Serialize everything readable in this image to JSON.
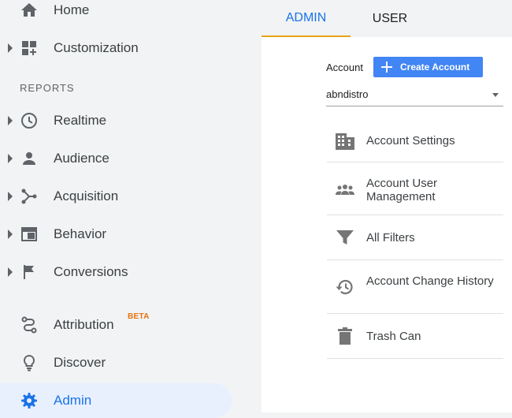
{
  "sidebar": {
    "items": [
      {
        "label": "Home",
        "icon": "home-icon"
      },
      {
        "label": "Customization",
        "icon": "customization-icon"
      },
      {
        "label": "Realtime",
        "icon": "clock-icon"
      },
      {
        "label": "Audience",
        "icon": "person-icon"
      },
      {
        "label": "Acquisition",
        "icon": "acquisition-icon"
      },
      {
        "label": "Behavior",
        "icon": "behavior-icon"
      },
      {
        "label": "Conversions",
        "icon": "flag-icon"
      },
      {
        "label": "Attribution",
        "icon": "attribution-icon",
        "badge": "BETA"
      },
      {
        "label": "Discover",
        "icon": "lightbulb-icon"
      },
      {
        "label": "Admin",
        "icon": "gear-icon",
        "active": true
      }
    ],
    "section_reports": "REPORTS"
  },
  "tabs": [
    {
      "label": "ADMIN",
      "active": true
    },
    {
      "label": "USER",
      "active": false
    }
  ],
  "admin": {
    "account_label": "Account",
    "create_account_label": "Create Account",
    "account_value": "abndistro",
    "menu": [
      {
        "label": "Account Settings",
        "icon": "building-icon"
      },
      {
        "label": "Account User Management",
        "icon": "people-icon"
      },
      {
        "label": "All Filters",
        "icon": "filter-icon"
      },
      {
        "label": "Account Change History",
        "icon": "history-icon"
      },
      {
        "label": "Trash Can",
        "icon": "trash-icon"
      }
    ]
  },
  "colors": {
    "accent": "#1a73e8",
    "active_bg": "#e8f0fe",
    "tab_underline": "#e8a316",
    "button": "#4285f4",
    "beta_badge": "#e8710a",
    "icon_grey": "#5f6368",
    "sidebar_bg": "#f1f3f4"
  }
}
